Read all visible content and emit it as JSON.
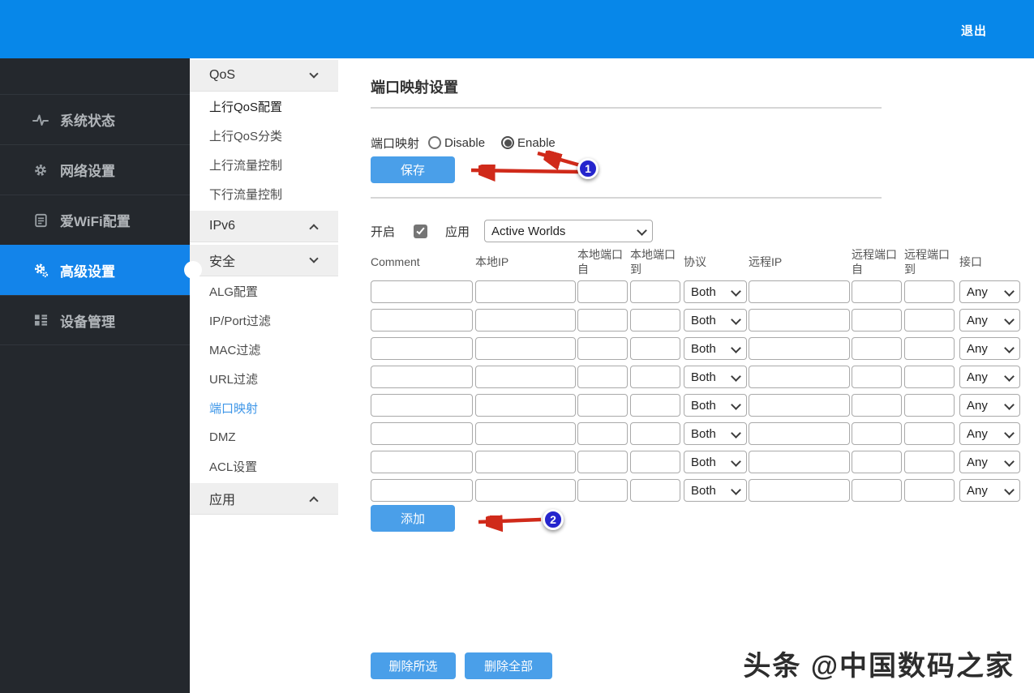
{
  "topbar": {
    "logout_label": "退出"
  },
  "sidebar": {
    "items": [
      {
        "label": "系统状态",
        "icon": "activity-icon",
        "active": false
      },
      {
        "label": "网络设置",
        "icon": "gear-icon",
        "active": false
      },
      {
        "label": "爱WiFi配置",
        "icon": "clipboard-icon",
        "active": false
      },
      {
        "label": "高级设置",
        "icon": "gears-icon",
        "active": true
      },
      {
        "label": "设备管理",
        "icon": "grid-icon",
        "active": false
      }
    ]
  },
  "submenu": {
    "entries": [
      {
        "type": "header",
        "label": "QoS",
        "chevron": "down"
      },
      {
        "type": "item",
        "label": "上行QoS配置",
        "emphasis": true,
        "active": false
      },
      {
        "type": "item",
        "label": "上行QoS分类",
        "emphasis": false,
        "active": false
      },
      {
        "type": "item",
        "label": "上行流量控制",
        "emphasis": false,
        "active": false
      },
      {
        "type": "item",
        "label": "下行流量控制",
        "emphasis": false,
        "active": false
      },
      {
        "type": "header",
        "label": "IPv6",
        "chevron": "up"
      },
      {
        "type": "header",
        "label": "安全",
        "chevron": "down"
      },
      {
        "type": "item",
        "label": "ALG配置",
        "emphasis": false,
        "active": false
      },
      {
        "type": "item",
        "label": "IP/Port过滤",
        "emphasis": false,
        "active": false
      },
      {
        "type": "item",
        "label": "MAC过滤",
        "emphasis": false,
        "active": false
      },
      {
        "type": "item",
        "label": "URL过滤",
        "emphasis": false,
        "active": false
      },
      {
        "type": "item",
        "label": "端口映射",
        "emphasis": false,
        "active": true
      },
      {
        "type": "item",
        "label": "DMZ",
        "emphasis": false,
        "active": false
      },
      {
        "type": "item",
        "label": "ACL设置",
        "emphasis": false,
        "active": false
      },
      {
        "type": "header",
        "label": "应用",
        "chevron": "up"
      }
    ]
  },
  "main": {
    "title": "端口映射设置",
    "toggle": {
      "label": "端口映射",
      "options": [
        {
          "label": "Disable",
          "selected": false
        },
        {
          "label": "Enable",
          "selected": true
        }
      ]
    },
    "save_button": "保存",
    "rule_bar": {
      "enable_label": "开启",
      "enable_checked": true,
      "app_label": "应用",
      "app_selected": "Active Worlds"
    },
    "table": {
      "headers": [
        {
          "lines": [
            "Comment"
          ]
        },
        {
          "lines": [
            "本地IP"
          ]
        },
        {
          "lines": [
            "本地端口",
            "自"
          ]
        },
        {
          "lines": [
            "本地端口",
            "到"
          ]
        },
        {
          "lines": [
            "协议"
          ]
        },
        {
          "lines": [
            "远程IP"
          ]
        },
        {
          "lines": [
            "远程端口",
            "自"
          ]
        },
        {
          "lines": [
            "远程端口",
            "到"
          ]
        },
        {
          "lines": [
            "接口"
          ]
        }
      ],
      "rows": [
        {
          "comment": "",
          "local_ip": "",
          "local_port_from": "",
          "local_port_to": "",
          "protocol": "Both",
          "remote_ip": "",
          "remote_port_from": "",
          "remote_port_to": "",
          "interface": "Any"
        },
        {
          "comment": "",
          "local_ip": "",
          "local_port_from": "",
          "local_port_to": "",
          "protocol": "Both",
          "remote_ip": "",
          "remote_port_from": "",
          "remote_port_to": "",
          "interface": "Any"
        },
        {
          "comment": "",
          "local_ip": "",
          "local_port_from": "",
          "local_port_to": "",
          "protocol": "Both",
          "remote_ip": "",
          "remote_port_from": "",
          "remote_port_to": "",
          "interface": "Any"
        },
        {
          "comment": "",
          "local_ip": "",
          "local_port_from": "",
          "local_port_to": "",
          "protocol": "Both",
          "remote_ip": "",
          "remote_port_from": "",
          "remote_port_to": "",
          "interface": "Any"
        },
        {
          "comment": "",
          "local_ip": "",
          "local_port_from": "",
          "local_port_to": "",
          "protocol": "Both",
          "remote_ip": "",
          "remote_port_from": "",
          "remote_port_to": "",
          "interface": "Any"
        },
        {
          "comment": "",
          "local_ip": "",
          "local_port_from": "",
          "local_port_to": "",
          "protocol": "Both",
          "remote_ip": "",
          "remote_port_from": "",
          "remote_port_to": "",
          "interface": "Any"
        },
        {
          "comment": "",
          "local_ip": "",
          "local_port_from": "",
          "local_port_to": "",
          "protocol": "Both",
          "remote_ip": "",
          "remote_port_from": "",
          "remote_port_to": "",
          "interface": "Any"
        },
        {
          "comment": "",
          "local_ip": "",
          "local_port_from": "",
          "local_port_to": "",
          "protocol": "Both",
          "remote_ip": "",
          "remote_port_from": "",
          "remote_port_to": "",
          "interface": "Any"
        }
      ]
    },
    "add_button": "添加",
    "delete_selected_button": "删除所选",
    "delete_all_button": "删除全部"
  },
  "annotations": {
    "badge1": "1",
    "badge2": "2"
  },
  "watermark": "头条 @中国数码之家",
  "colors": {
    "topbar_blue": "#0787e9",
    "sidebar_dark": "#24282d",
    "active_blue": "#1384ea",
    "button_blue": "#4a9fe9",
    "link_blue": "#3f97e8",
    "arrow_red": "#d02a1a",
    "badge_blue": "#2525cd"
  }
}
